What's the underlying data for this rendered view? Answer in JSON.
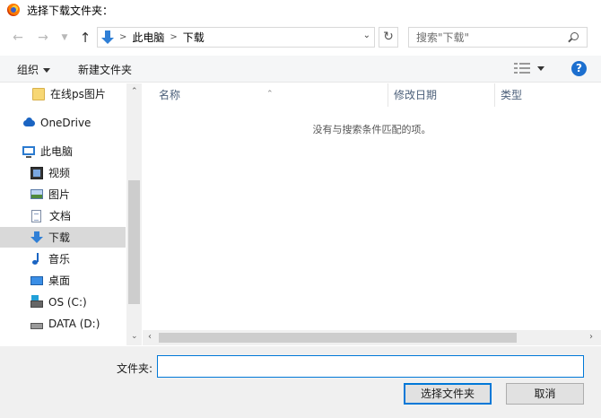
{
  "window": {
    "title": "选择下载文件夹：",
    "app_icon": "firefox-icon"
  },
  "address": {
    "back_icon": "back-arrow-icon",
    "forward_icon": "forward-arrow-icon",
    "down_icon": "dropdown-chevron-icon",
    "up_icon": "up-arrow-icon",
    "crumbs": [
      "此电脑",
      "下载"
    ],
    "separator": ">",
    "refresh_icon": "refresh-icon",
    "search_placeholder": "搜索\"下载\""
  },
  "toolbar": {
    "organize": "组织",
    "new_folder": "新建文件夹",
    "help": "?"
  },
  "nav": {
    "items": [
      {
        "label": "在线ps图片",
        "icon": "folder-icon"
      },
      {
        "label": "OneDrive",
        "icon": "onedrive-icon"
      },
      {
        "label": "此电脑",
        "icon": "this-pc-icon"
      },
      {
        "label": "视频",
        "icon": "videos-icon"
      },
      {
        "label": "图片",
        "icon": "pictures-icon"
      },
      {
        "label": "文档",
        "icon": "documents-icon"
      },
      {
        "label": "下载",
        "icon": "downloads-icon",
        "selected": true
      },
      {
        "label": "音乐",
        "icon": "music-icon"
      },
      {
        "label": "桌面",
        "icon": "desktop-icon"
      },
      {
        "label": "OS (C:)",
        "icon": "os-drive-icon"
      },
      {
        "label": "DATA (D:)",
        "icon": "data-drive-icon"
      }
    ]
  },
  "main": {
    "columns": [
      "名称",
      "修改日期",
      "类型"
    ],
    "empty_message": "没有与搜索条件匹配的项。"
  },
  "bottom": {
    "folder_label": "文件夹:",
    "folder_value": "",
    "select_button": "选择文件夹",
    "cancel_button": "取消"
  },
  "colors": {
    "accent": "#0078d7",
    "selected_bg": "#d9d9d9",
    "help_blue": "#1c6fcf"
  }
}
